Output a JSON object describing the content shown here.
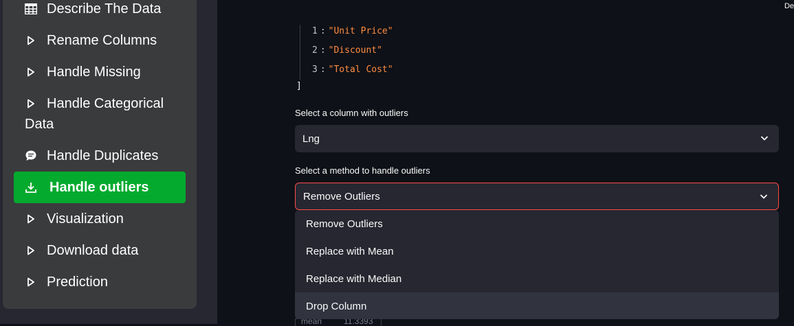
{
  "sidebar": {
    "items": [
      {
        "label": "Describe The Data",
        "icon": "table-icon"
      },
      {
        "label": "Rename Columns",
        "icon": "play-outline-icon"
      },
      {
        "label": "Handle Missing",
        "icon": "play-outline-icon"
      },
      {
        "label": "Handle Categorical",
        "label2": "Data",
        "icon": "play-outline-icon"
      },
      {
        "label": "Handle Duplicates",
        "icon": "chat-bubble-icon"
      },
      {
        "label": "Handle outliers",
        "icon": "download-icon",
        "active": true
      },
      {
        "label": "Visualization",
        "icon": "play-outline-icon"
      },
      {
        "label": "Download data",
        "icon": "play-outline-icon"
      },
      {
        "label": "Prediction",
        "icon": "play-outline-icon"
      }
    ],
    "active_color": "#04aa2e"
  },
  "topright": {
    "text": "De"
  },
  "json_view": {
    "lines": [
      {
        "index": "1",
        "value": "\"Unit Price\""
      },
      {
        "index": "2",
        "value": "\"Discount\""
      },
      {
        "index": "3",
        "value": "\"Total Cost\""
      }
    ],
    "close": "]"
  },
  "column_select": {
    "label": "Select a column with outliers",
    "value": "Lng"
  },
  "method_select": {
    "label": "Select a method to handle outliers",
    "value": "Remove Outliers",
    "options": [
      "Remove Outliers",
      "Replace with Mean",
      "Replace with Median",
      "Drop Column"
    ],
    "highlighted": "Drop Column"
  },
  "peek": {
    "left": "mean",
    "right": "11.3393"
  },
  "colors": {
    "accent": "#ff4b4b",
    "string": "#ff8c42",
    "background": "#0e1117"
  }
}
